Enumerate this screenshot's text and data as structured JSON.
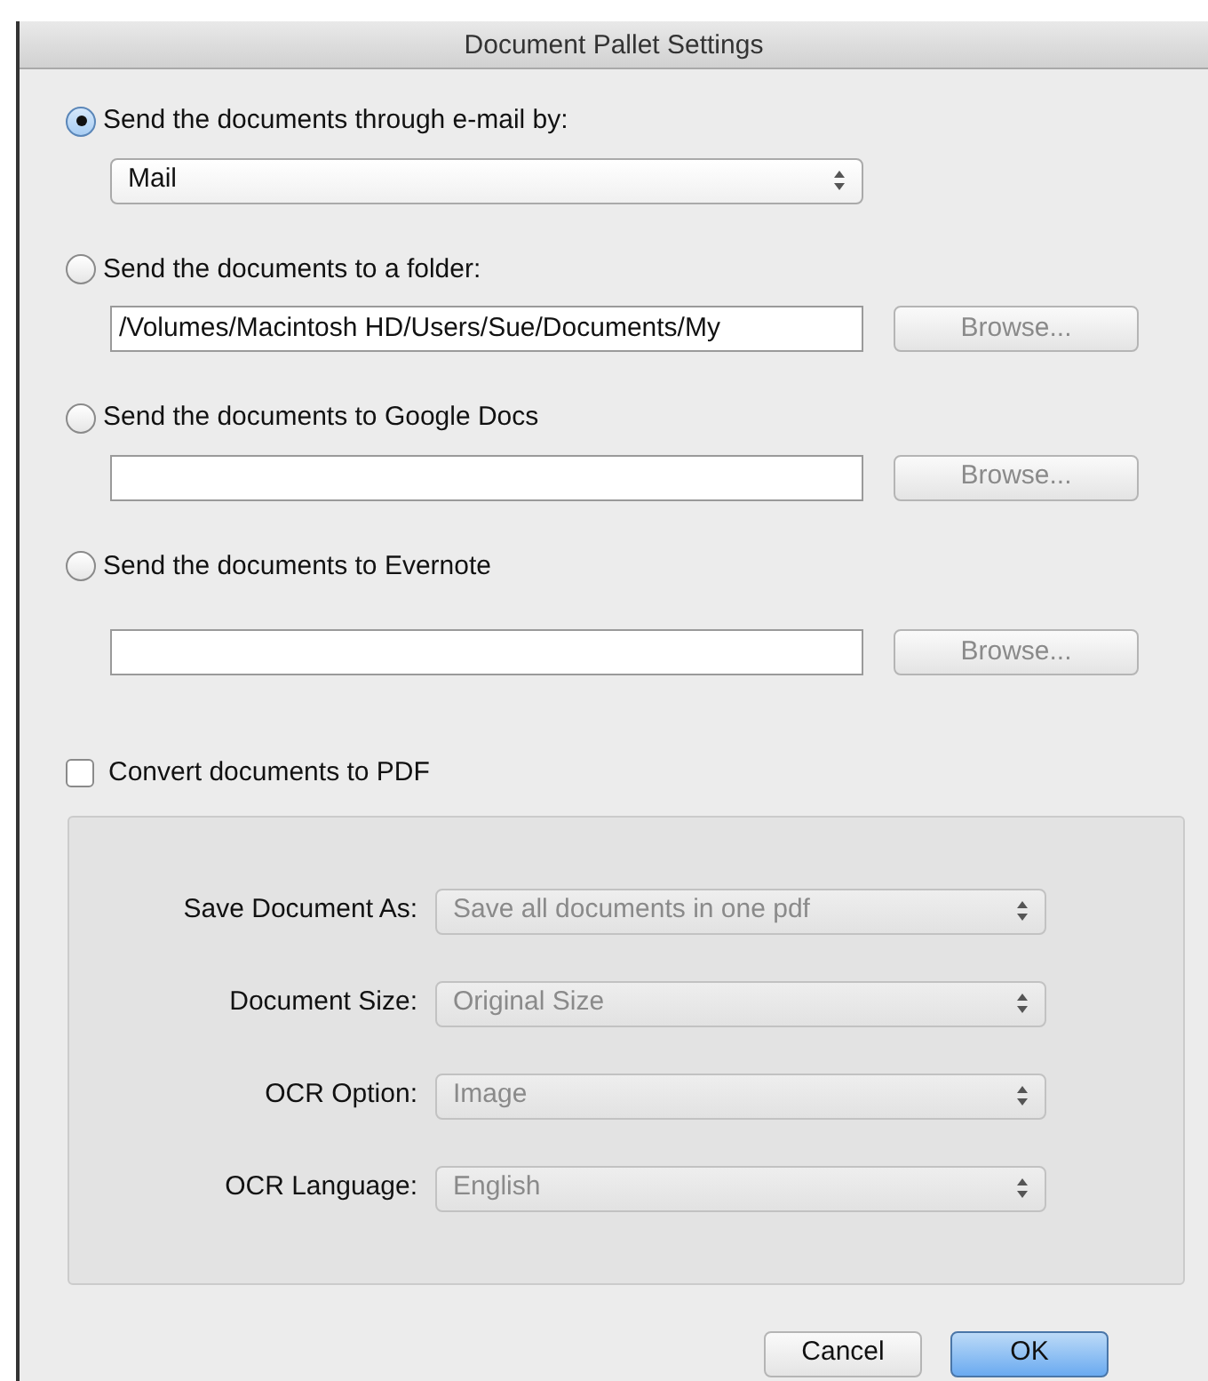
{
  "window": {
    "title": "Document Pallet Settings"
  },
  "destinations": [
    {
      "kind": "popup",
      "label": "Send the documents through e-mail by:",
      "selected": true,
      "value": "Mail"
    },
    {
      "kind": "path",
      "label": "Send the documents to a folder:",
      "selected": false,
      "value": "/Volumes/Macintosh HD/Users/Sue/Documents/My",
      "button": "Browse...",
      "button_disabled": true
    },
    {
      "kind": "path",
      "label": "Send the documents to Google Docs",
      "selected": false,
      "button": "Browse...",
      "button_disabled": true
    },
    {
      "kind": "path",
      "label": "Send the documents to Evernote",
      "selected": false,
      "button": "Browse...",
      "button_disabled": true
    }
  ],
  "convert": {
    "label": "Convert documents to PDF",
    "checked": false
  },
  "pdf_options": [
    {
      "label": "Save Document As:",
      "value": "Save all documents in one pdf",
      "disabled": true
    },
    {
      "label": "Document Size:",
      "value": "Original Size",
      "disabled": true
    },
    {
      "label": "OCR Option:",
      "value": "Image",
      "disabled": true
    },
    {
      "label": "OCR Language:",
      "value": "English",
      "disabled": true
    }
  ],
  "buttons": [
    {
      "label": "Cancel",
      "default": false
    },
    {
      "label": "OK",
      "default": true
    }
  ]
}
